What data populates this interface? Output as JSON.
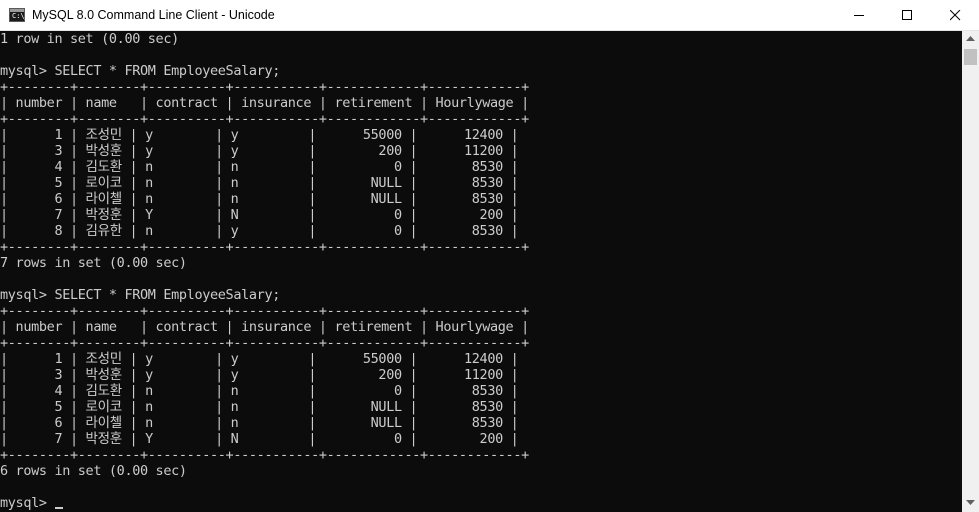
{
  "window": {
    "title": "MySQL 8.0 Command Line Client - Unicode",
    "icon": "cmd-app-icon",
    "icon_text": "C:\\_",
    "controls": [
      "minimize-icon",
      "maximize-icon",
      "close-icon"
    ]
  },
  "console": {
    "lines": [
      "1 row in set (0.00 sec)",
      "",
      "mysql> SELECT * FROM EmployeeSalary;",
      "+--------+--------+----------+-----------+------------+------------+",
      "| number | name   | contract | insurance | retirement | Hourlywage |",
      "+--------+--------+----------+-----------+------------+------------+",
      "|      1 | 조성민 | y        | y         |      55000 |      12400 |",
      "|      3 | 박성훈 | y        | y         |        200 |      11200 |",
      "|      4 | 김도환 | n        | n         |          0 |       8530 |",
      "|      5 | 로이코 | n        | n         |       NULL |       8530 |",
      "|      6 | 라이첼 | n        | n         |       NULL |       8530 |",
      "|      7 | 박정훈 | Y        | N         |          0 |        200 |",
      "|      8 | 김유한 | n        | y         |          0 |       8530 |",
      "+--------+--------+----------+-----------+------------+------------+",
      "7 rows in set (0.00 sec)",
      "",
      "mysql> SELECT * FROM EmployeeSalary;",
      "+--------+--------+----------+-----------+------------+------------+",
      "| number | name   | contract | insurance | retirement | Hourlywage |",
      "+--------+--------+----------+-----------+------------+------------+",
      "|      1 | 조성민 | y        | y         |      55000 |      12400 |",
      "|      3 | 박성훈 | y        | y         |        200 |      11200 |",
      "|      4 | 김도환 | n        | n         |          0 |       8530 |",
      "|      5 | 로이코 | n        | n         |       NULL |       8530 |",
      "|      6 | 라이첼 | n        | n         |       NULL |       8530 |",
      "|      7 | 박정훈 | Y        | N         |          0 |        200 |",
      "+--------+--------+----------+-----------+------------+------------+",
      "6 rows in set (0.00 sec)",
      "",
      "mysql> "
    ]
  },
  "colors": {
    "console_bg": "#0c0c0c",
    "console_text": "#cccccc",
    "titlebar_bg": "#ffffff",
    "scrollbar_track": "#f0f0f0",
    "scrollbar_thumb": "#c1c1c1"
  }
}
